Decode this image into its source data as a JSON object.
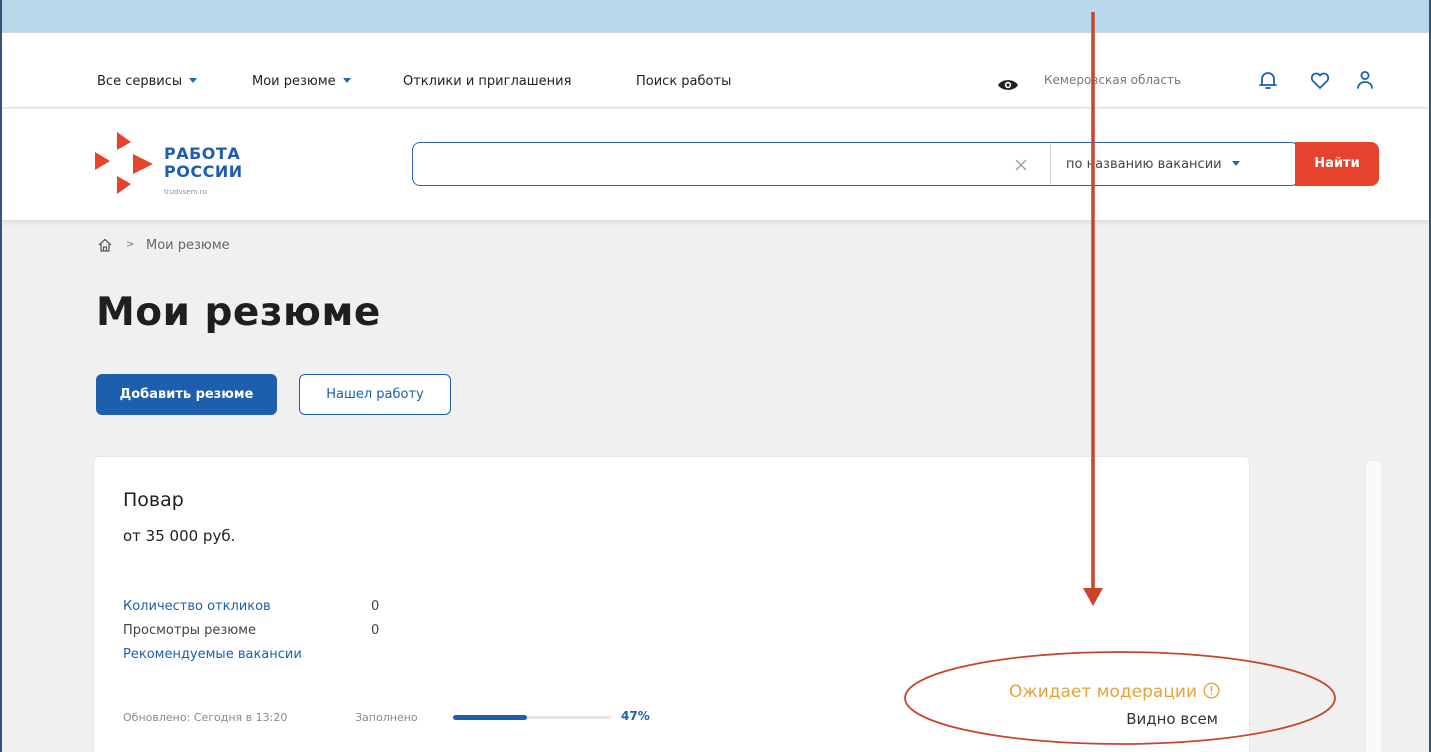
{
  "nav": {
    "items": [
      {
        "label": "Все сервисы",
        "dropdown": true
      },
      {
        "label": "Мои резюме",
        "dropdown": true
      },
      {
        "label": "Отклики и приглашения",
        "dropdown": false
      },
      {
        "label": "Поиск работы",
        "dropdown": false
      }
    ],
    "region": "Кемеровская область",
    "icons": [
      "eye-icon",
      "bell-icon",
      "heart-icon",
      "user-icon"
    ]
  },
  "header": {
    "logo_line1": "РАБОТА",
    "logo_line2": "РОССИИ",
    "logo_url": "trudvsem.ru",
    "search_value": "",
    "search_mode": "по названию вакансии",
    "find_label": "Найти"
  },
  "breadcrumb": {
    "separator": ">",
    "current": "Мои резюме"
  },
  "page": {
    "title": "Мои резюме",
    "add_button": "Добавить резюме",
    "found_button": "Нашел работу"
  },
  "resume": {
    "title": "Повар",
    "salary": "от 35 000 руб.",
    "stats": [
      {
        "label": "Количество откликов",
        "value": "0",
        "link": true
      },
      {
        "label": "Просмотры резюме",
        "value": "0",
        "link": false
      },
      {
        "label": "Рекомендуемые вакансии",
        "value": "",
        "link": true
      }
    ],
    "updated": "Обновлено: Сегодня в 13:20",
    "filled_label": "Заполнено",
    "filled_percent": 47,
    "filled_text": "47%",
    "status": "Ожидает модерации",
    "visibility": "Видно всем"
  },
  "colors": {
    "brand_blue": "#1d5fad",
    "accent_red": "#e5432e",
    "status_orange": "#e6a23a",
    "annotation": "#c8442a"
  }
}
